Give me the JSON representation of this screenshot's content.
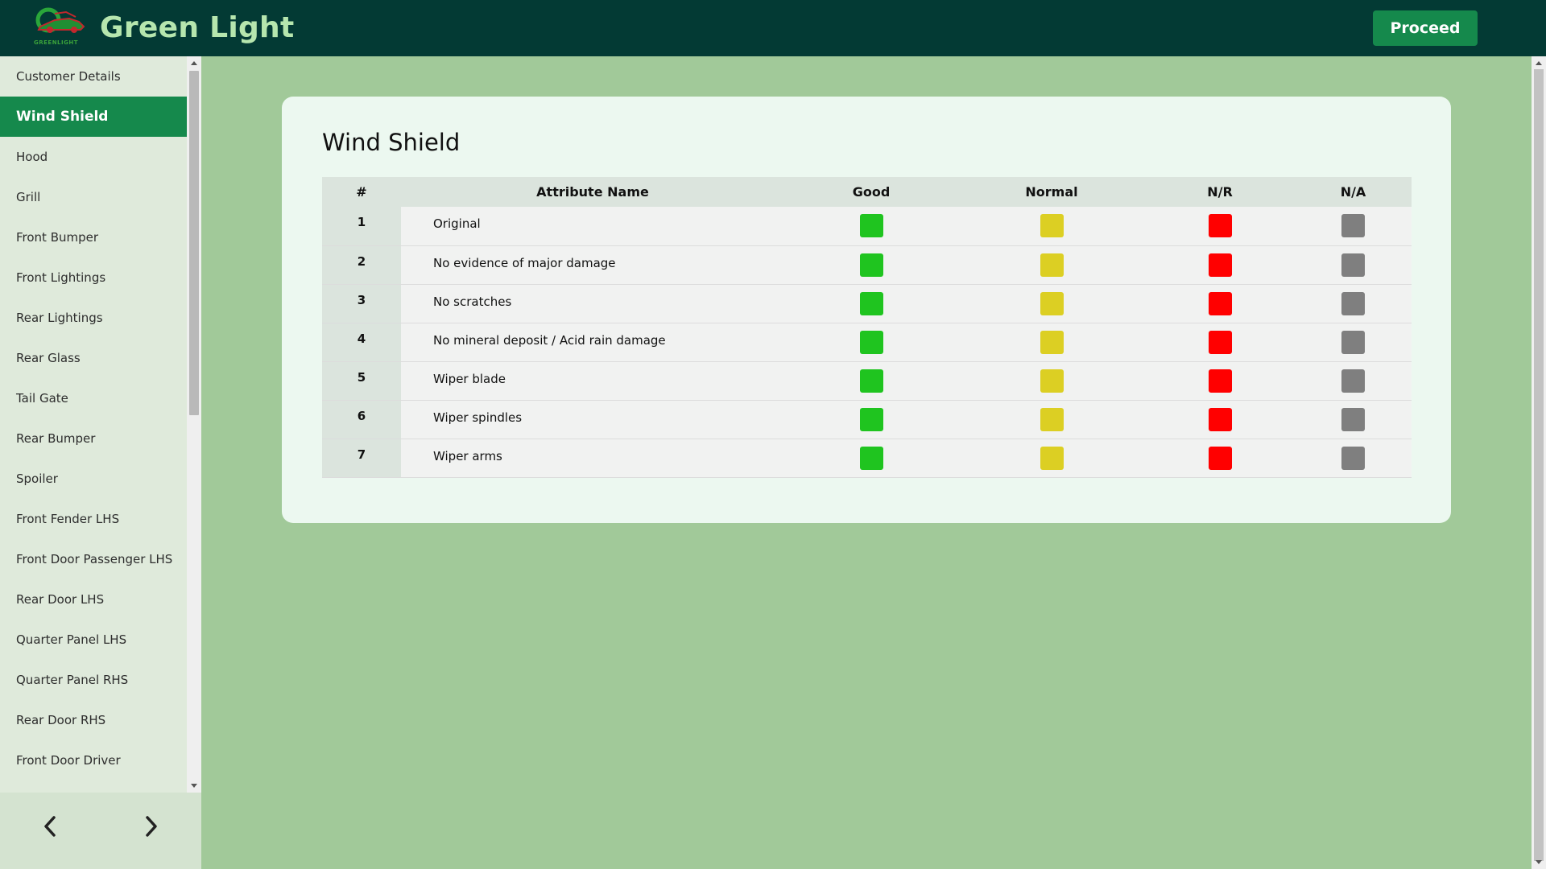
{
  "header": {
    "app_title": "Green Light",
    "logo_text": "GREENLIGHT",
    "proceed_label": "Proceed"
  },
  "sidebar": {
    "items": [
      {
        "label": "Customer Details",
        "active": false
      },
      {
        "label": "Wind Shield",
        "active": true
      },
      {
        "label": "Hood",
        "active": false
      },
      {
        "label": "Grill",
        "active": false
      },
      {
        "label": "Front Bumper",
        "active": false
      },
      {
        "label": "Front Lightings",
        "active": false
      },
      {
        "label": "Rear Lightings",
        "active": false
      },
      {
        "label": "Rear Glass",
        "active": false
      },
      {
        "label": "Tail Gate",
        "active": false
      },
      {
        "label": "Rear Bumper",
        "active": false
      },
      {
        "label": "Spoiler",
        "active": false
      },
      {
        "label": "Front Fender LHS",
        "active": false
      },
      {
        "label": "Front Door Passenger LHS",
        "active": false
      },
      {
        "label": "Rear Door LHS",
        "active": false
      },
      {
        "label": "Quarter Panel LHS",
        "active": false
      },
      {
        "label": "Quarter Panel RHS",
        "active": false
      },
      {
        "label": "Rear Door RHS",
        "active": false
      },
      {
        "label": "Front Door Driver",
        "active": false
      }
    ],
    "prev_icon": "chevron-left-icon",
    "next_icon": "chevron-right-icon"
  },
  "main": {
    "section_title": "Wind Shield",
    "table": {
      "headers": [
        "#",
        "Attribute Name",
        "Good",
        "Normal",
        "N/R",
        "N/A"
      ],
      "rows": [
        {
          "num": "1",
          "name": "Original"
        },
        {
          "num": "2",
          "name": "No evidence of major damage"
        },
        {
          "num": "3",
          "name": "No scratches"
        },
        {
          "num": "4",
          "name": "No mineral deposit / Acid rain damage"
        },
        {
          "num": "5",
          "name": "Wiper blade"
        },
        {
          "num": "6",
          "name": "Wiper spindles"
        },
        {
          "num": "7",
          "name": "Wiper arms"
        }
      ]
    }
  },
  "colors": {
    "header_bg": "#033a34",
    "brand_text": "#b6e6ae",
    "accent": "#15894c",
    "page_bg": "#a1c999",
    "good": "#1fc41f",
    "normal": "#dccf23",
    "nr": "#ff0000",
    "na": "#7f7f7f"
  }
}
